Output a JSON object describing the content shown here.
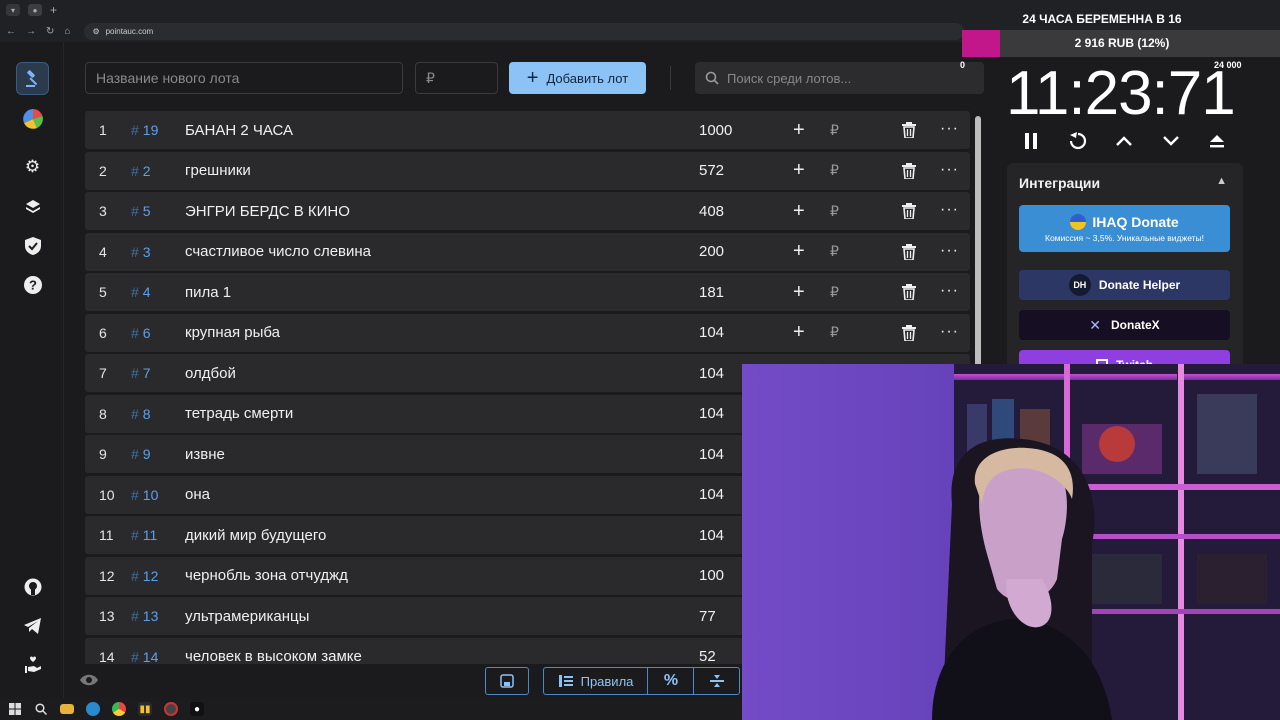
{
  "browser": {
    "url": "pointauc.com"
  },
  "top": {
    "lot_placeholder": "Название нового лота",
    "price_placeholder": "₽",
    "add_label": "Добавить лот",
    "search_placeholder": "Поиск среди лотов..."
  },
  "lots": [
    {
      "n": "1",
      "id": "19",
      "name": "БАНАН 2 ЧАСА",
      "amount": "1000",
      "actions": true
    },
    {
      "n": "2",
      "id": "2",
      "name": "грешники",
      "amount": "572",
      "actions": true
    },
    {
      "n": "3",
      "id": "5",
      "name": "ЭНГРИ БЕРДС В КИНО",
      "amount": "408",
      "actions": true
    },
    {
      "n": "4",
      "id": "3",
      "name": "счастливое число слевина",
      "amount": "200",
      "actions": true
    },
    {
      "n": "5",
      "id": "4",
      "name": "пила 1",
      "amount": "181",
      "actions": true
    },
    {
      "n": "6",
      "id": "6",
      "name": "крупная рыба",
      "amount": "104",
      "actions": true
    },
    {
      "n": "7",
      "id": "7",
      "name": "олдбой",
      "amount": "104",
      "actions": false
    },
    {
      "n": "8",
      "id": "8",
      "name": "тетрадь смерти",
      "amount": "104",
      "actions": false
    },
    {
      "n": "9",
      "id": "9",
      "name": "извне",
      "amount": "104",
      "actions": false
    },
    {
      "n": "10",
      "id": "10",
      "name": "она",
      "amount": "104",
      "actions": false
    },
    {
      "n": "11",
      "id": "11",
      "name": "дикий мир будущего",
      "amount": "104",
      "actions": false
    },
    {
      "n": "12",
      "id": "12",
      "name": "чернобль зона отчуджд",
      "amount": "100",
      "actions": false
    },
    {
      "n": "13",
      "id": "13",
      "name": "ультрамериканцы",
      "amount": "77",
      "actions": false
    },
    {
      "n": "14",
      "id": "14",
      "name": "человек в высоком замке",
      "amount": "52",
      "actions": false
    }
  ],
  "lot_actions": {
    "plus": "+",
    "rub": "₽",
    "dots": "···",
    "hash": "#"
  },
  "bottom": {
    "rules_label": "Правила",
    "percent_label": "%"
  },
  "overlay": {
    "title": "24 ЧАСА БЕРЕМЕННА В 16",
    "progress_label": "2 916 RUB (12%)",
    "progress_fraction": 0.12,
    "min": "0",
    "max": "24 000",
    "progress_color": "#c2178a"
  },
  "timer": {
    "value": "11:23:71"
  },
  "integrations": {
    "title": "Интеграции",
    "ihaq_name": "IHAQ Donate",
    "ihaq_sub": "Комиссия ~ 3,5%. Уникальные виджеты!",
    "donate_helper": "Donate Helper",
    "donatex": "DonateX",
    "twitch": "Twitch"
  }
}
